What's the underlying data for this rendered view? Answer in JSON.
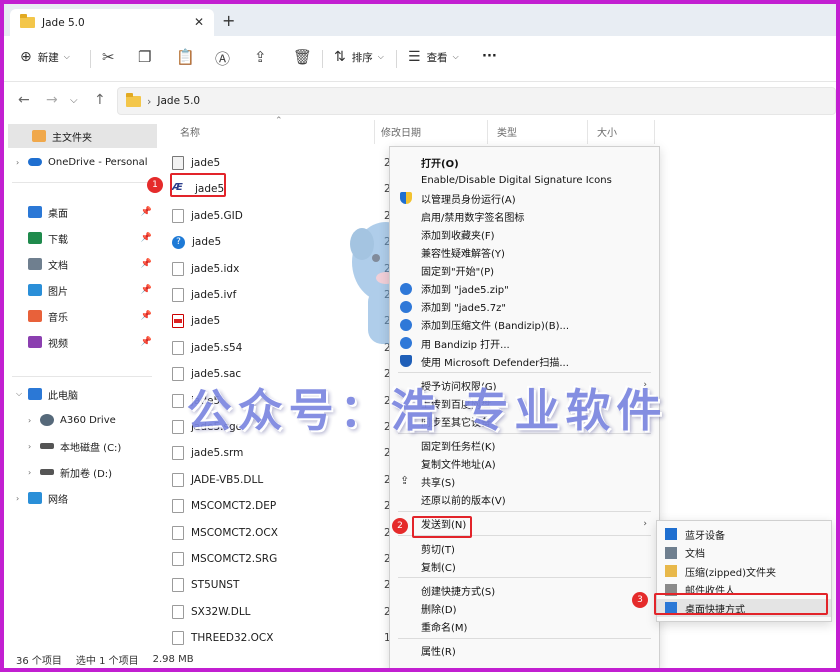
{
  "window": {
    "tab_title": "Jade 5.0",
    "tab_close": "✕",
    "new_tab": "+"
  },
  "toolbar": {
    "new_label": "新建",
    "sort_label": "排序",
    "view_label": "查看",
    "more_label": "···"
  },
  "address": {
    "path": "Jade 5.0"
  },
  "sidebar": {
    "home": "主文件夹",
    "onedrive": "OneDrive - Personal",
    "quick": [
      {
        "label": "桌面",
        "color": "#2b78d6"
      },
      {
        "label": "下载",
        "color": "#1f8a4c"
      },
      {
        "label": "文档",
        "color": "#6f7f8f"
      },
      {
        "label": "图片",
        "color": "#2a8fd8"
      },
      {
        "label": "音乐",
        "color": "#e8613a"
      },
      {
        "label": "视频",
        "color": "#8b3fb0"
      }
    ],
    "this_pc": "此电脑",
    "drives": [
      "A360 Drive",
      "本地磁盘 (C:)",
      "新加卷 (D:)"
    ],
    "network": "网络"
  },
  "columns": {
    "name": "名称",
    "modified": "修改日期",
    "type": "类型",
    "size": "大小"
  },
  "files": [
    {
      "name": "jade5",
      "date": "2",
      "icon": "app"
    },
    {
      "name": "jade5",
      "date": "2",
      "icon": "ae"
    },
    {
      "name": "jade5.GID",
      "date": "2",
      "icon": "doc"
    },
    {
      "name": "jade5",
      "date": "2",
      "icon": "help"
    },
    {
      "name": "jade5.idx",
      "date": "2",
      "icon": "doc"
    },
    {
      "name": "jade5.ivf",
      "date": "2",
      "icon": "doc"
    },
    {
      "name": "jade5",
      "date": "2",
      "icon": "red"
    },
    {
      "name": "jade5.s54",
      "date": "2",
      "icon": "doc"
    },
    {
      "name": "jade5.sac",
      "date": "2",
      "icon": "doc"
    },
    {
      "name": "jade5",
      "date": "2",
      "icon": "doc"
    },
    {
      "name": "jade5.sgc",
      "date": "2",
      "icon": "doc"
    },
    {
      "name": "jade5.srm",
      "date": "2",
      "icon": "doc"
    },
    {
      "name": "JADE-VB5.DLL",
      "date": "2",
      "icon": "doc"
    },
    {
      "name": "MSCOMCT2.DEP",
      "date": "2",
      "icon": "doc"
    },
    {
      "name": "MSCOMCT2.OCX",
      "date": "2",
      "icon": "doc"
    },
    {
      "name": "MSCOMCT2.SRG",
      "date": "2",
      "icon": "doc"
    },
    {
      "name": "ST5UNST",
      "date": "2",
      "icon": "doc"
    },
    {
      "name": "SX32W.DLL",
      "date": "2",
      "icon": "doc"
    },
    {
      "name": "THREED32.OCX",
      "date": "1",
      "icon": "doc"
    }
  ],
  "context_menu": [
    {
      "label": "打开(O)",
      "bold": true
    },
    {
      "label": "Enable/Disable Digital Signature Icons"
    },
    {
      "label": "以管理员身份运行(A)",
      "icon": "shield"
    },
    {
      "label": "启用/禁用数字签名图标"
    },
    {
      "label": "添加到收藏夹(F)"
    },
    {
      "label": "兼容性疑难解答(Y)"
    },
    {
      "label": "固定到\"开始\"(P)"
    },
    {
      "label": "添加到 \"jade5.zip\"",
      "icon": "bandizip"
    },
    {
      "label": "添加到 \"jade5.7z\"",
      "icon": "bandizip"
    },
    {
      "label": "添加到压缩文件 (Bandizip)(B)...",
      "icon": "bandizip"
    },
    {
      "label": "用 Bandizip 打开...",
      "icon": "bandizip"
    },
    {
      "label": "使用 Microsoft Defender扫描...",
      "icon": "defender"
    },
    {
      "label": "授予访问权限(G)",
      "submenu": true
    },
    {
      "label": "上传到百度网盘"
    },
    {
      "label": "同步至其它设备"
    },
    {
      "label": "固定到任务栏(K)"
    },
    {
      "label": "复制文件地址(A)"
    },
    {
      "label": "共享(S)",
      "icon": "share"
    },
    {
      "label": "还原以前的版本(V)"
    },
    {
      "label": "发送到(N)",
      "submenu": true
    },
    {
      "label": "剪切(T)"
    },
    {
      "label": "复制(C)"
    },
    {
      "label": "创建快捷方式(S)"
    },
    {
      "label": "删除(D)"
    },
    {
      "label": "重命名(M)"
    },
    {
      "label": "属性(R)"
    }
  ],
  "send_to": [
    {
      "label": "蓝牙设备",
      "color": "#1f6fd0"
    },
    {
      "label": "文档",
      "color": "#6f7f8f"
    },
    {
      "label": "压缩(zipped)文件夹",
      "color": "#e8b84a"
    },
    {
      "label": "邮件收件人",
      "color": "#8a8a8a"
    },
    {
      "label": "桌面快捷方式",
      "color": "#2b78d6"
    }
  ],
  "badges": [
    "1",
    "2",
    "3"
  ],
  "status": {
    "count": "36 个项目",
    "selected": "选中 1 个项目",
    "size": "2.98 MB"
  },
  "watermark": "公众号：浩 专业软件"
}
